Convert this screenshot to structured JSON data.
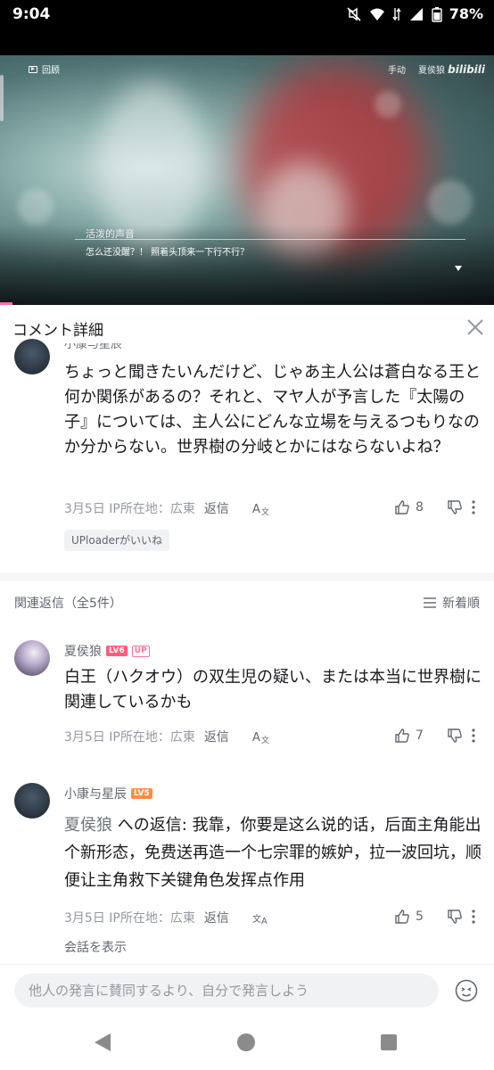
{
  "status_bar": {
    "time": "9:04",
    "battery": "78%",
    "icons": [
      "mute-icon",
      "wifi-icon",
      "data-icon",
      "signal-icon",
      "battery-icon"
    ]
  },
  "video": {
    "replay_label": "回顾",
    "mode_label": "手动",
    "channel_label": "夏侯狼",
    "watermark": "bilibili",
    "speaker": "活泼的声音",
    "subtitle": "怎么还没醒？！ 照着头顶来一下行不行？",
    "progress_percent": 2.5
  },
  "header": {
    "title": "コメント詳細"
  },
  "main_comment": {
    "author": "小康与星辰",
    "text": "ちょっと聞きたいんだけど、じゃあ主人公は蒼白なる王と何か関係があるの？それと、マヤ人が予言した『太陽の子』については、主人公にどんな立場を与えるつもりなのか分からない。世界樹の分岐とかにはならないよね？",
    "date_location": "3月5日 IP所在地：広東",
    "reply_label": "返信",
    "likes": "8",
    "uploader_liked": "UPloaderがいいね"
  },
  "replies_section": {
    "title": "関連返信（全5件）",
    "sort_label": "新着順"
  },
  "replies": [
    {
      "author": "夏侯狼",
      "level": "LV6",
      "up_badge": "UP",
      "text": "白王（ハクオウ）の双生児の疑い、または本当に世界樹に関連しているかも",
      "date_location": "3月5日 IP所在地：広東",
      "reply_label": "返信",
      "likes": "7"
    },
    {
      "author": "小康与星辰",
      "level": "LV5",
      "reply_to": "夏侯狼",
      "reply_prefix": " への返信: ",
      "text": "我靠，你要是这么说的话，后面主角能出个新形态，免费送再造一个七宗罪的嫉妒，拉一波回坑，顺便让主角救下关键角色发挥点作用",
      "date_location": "3月5日 IP所在地：広東",
      "reply_label": "返信",
      "likes": "5",
      "show_conversation": "会話を表示"
    }
  ],
  "input": {
    "placeholder": "他人の発言に賛同するより、自分で発言しよう"
  },
  "colors": {
    "accent_pink": "#fb7299",
    "lv6": "#ff5c7c",
    "lv5": "#ff8c45",
    "text_secondary": "#9499a0"
  }
}
